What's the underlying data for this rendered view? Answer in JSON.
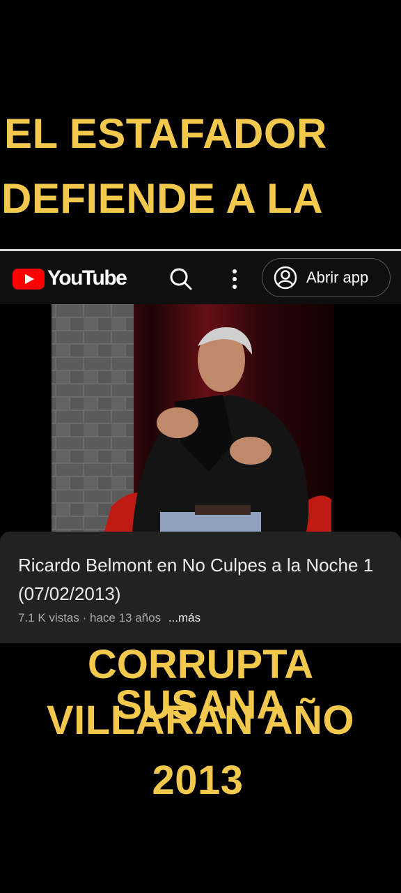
{
  "overlay_top": {
    "line1": "EL ESTAFADOR",
    "line2": "DEFIENDE A LA"
  },
  "youtube_bar": {
    "logo_text": "YouTube",
    "open_app_label": "Abrir app",
    "icons": [
      "youtube-play-icon",
      "search-icon",
      "more-vert-icon",
      "account-icon"
    ]
  },
  "video_info": {
    "title": "Ricardo Belmont en No Culpes a la Noche 1 (07/02/2013)",
    "views": "7.1 K vistas",
    "separator": " · ",
    "age": "hace 13 años",
    "more": "...más"
  },
  "overlay_bottom": {
    "line1": "CORRUPTA SUSANA",
    "line2": "VILLARAN AÑO",
    "line3": "2013"
  },
  "colors": {
    "caption": "#f2c94c",
    "youtube_red": "#ff0000",
    "bar_bg": "#0f0f0f",
    "card_bg": "#222222"
  }
}
